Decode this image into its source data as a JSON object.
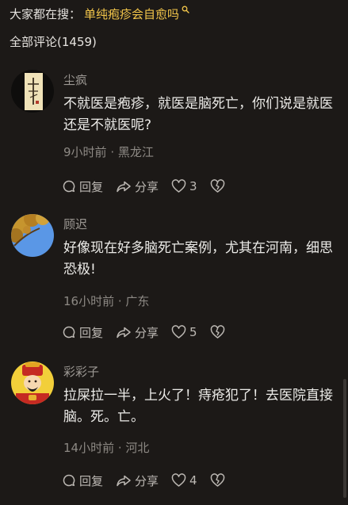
{
  "search": {
    "prefix": "大家都在搜：",
    "keyword": "单纯疱疹会自愈吗"
  },
  "comments_header": {
    "label": "全部评论(1459)"
  },
  "actions": {
    "reply_label": "回复",
    "share_label": "分享"
  },
  "comments": [
    {
      "username": "尘疯",
      "avatar": "calligraphy-avatar",
      "content": "不就医是疱疹，就医是脑死亡，你们说是就医还是不就医呢?",
      "time": "9小时前",
      "location": "黑龙江",
      "likes": "3"
    },
    {
      "username": "顾迟",
      "avatar": "tree-sky-avatar",
      "content": "好像现在好多脑死亡案例，尤其在河南，细思恐极!",
      "time": "16小时前",
      "location": "广东",
      "likes": "5"
    },
    {
      "username": "彩彩子",
      "avatar": "god-of-wealth-avatar",
      "content": "拉屎拉一半，上火了！痔疮犯了！去医院直接脑。死。亡。",
      "time": "14小时前",
      "location": "河北",
      "likes": "4"
    }
  ],
  "colors": {
    "background": "#1c1917",
    "keyword": "#f3c64a",
    "meta": "#8d8984",
    "username": "#9c9893"
  }
}
